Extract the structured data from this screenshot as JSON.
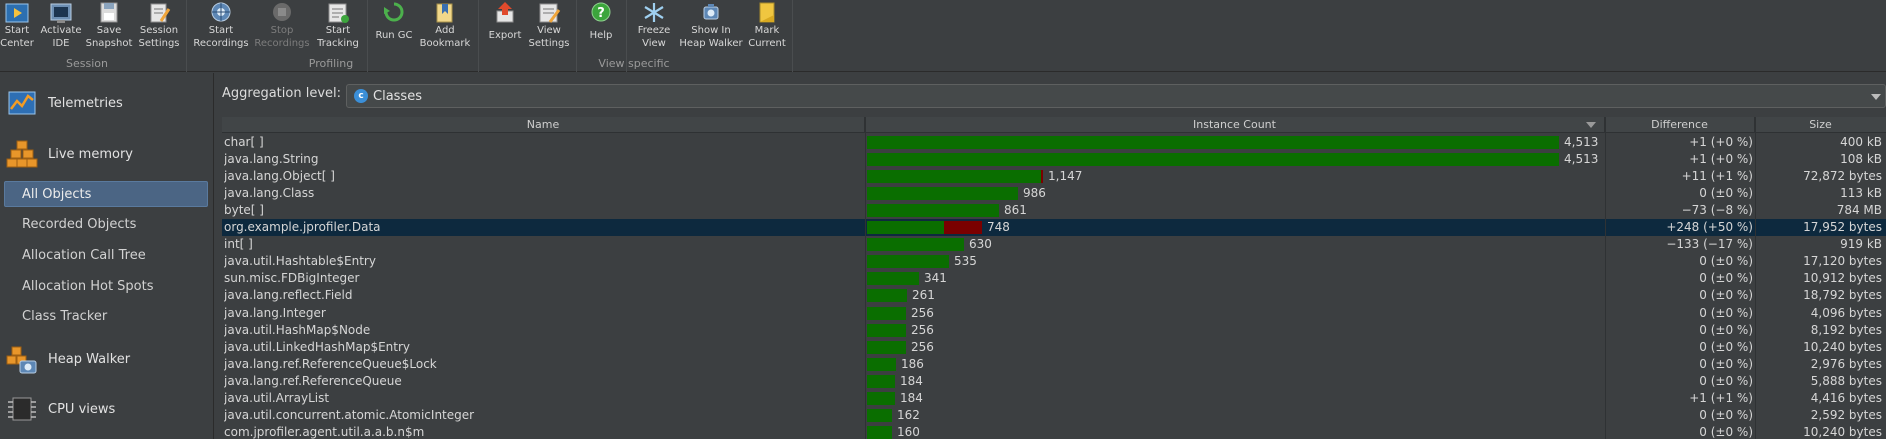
{
  "toolbar": {
    "buttons": [
      {
        "label": "Start\nCenter",
        "icon": "start-center-icon"
      },
      {
        "label": "Activate\nIDE",
        "icon": "activate-ide-icon"
      },
      {
        "label": "Save\nSnapshot",
        "icon": "save-snapshot-icon"
      },
      {
        "label": "Session\nSettings",
        "icon": "session-settings-icon"
      },
      {
        "label": "Start\nRecordings",
        "icon": "start-recordings-icon"
      },
      {
        "label": "Stop\nRecordings",
        "icon": "stop-recordings-icon",
        "disabled": true
      },
      {
        "label": "Start\nTracking",
        "icon": "start-tracking-icon"
      },
      {
        "label": "Run GC",
        "icon": "run-gc-icon"
      },
      {
        "label": "Add\nBookmark",
        "icon": "add-bookmark-icon"
      },
      {
        "label": "Export",
        "icon": "export-icon"
      },
      {
        "label": "View\nSettings",
        "icon": "view-settings-icon"
      },
      {
        "label": "Help",
        "icon": "help-icon"
      },
      {
        "label": "Freeze\nView",
        "icon": "freeze-view-icon"
      },
      {
        "label": "Show In\nHeap Walker",
        "icon": "show-in-heap-walker-icon"
      },
      {
        "label": "Mark\nCurrent",
        "icon": "mark-current-icon"
      }
    ],
    "groups": [
      "Session",
      "Profiling",
      "View specific"
    ]
  },
  "sidebar": {
    "sections": [
      {
        "label": "Telemetries",
        "icon": "telemetries-icon"
      },
      {
        "label": "Live memory",
        "icon": "live-memory-icon"
      },
      {
        "label": "Heap Walker",
        "icon": "heap-walker-icon"
      },
      {
        "label": "CPU views",
        "icon": "cpu-views-icon"
      }
    ],
    "items": [
      "All Objects",
      "Recorded Objects",
      "Allocation Call Tree",
      "Allocation Hot Spots",
      "Class Tracker"
    ],
    "selected_item": "All Objects"
  },
  "aggregation": {
    "label": "Aggregation level:",
    "value": "Classes",
    "icon_letter": "c"
  },
  "table": {
    "columns": [
      "Name",
      "Instance Count",
      "Difference",
      "Size"
    ],
    "sorted_column": "Instance Count",
    "max_count": 4513,
    "rows": [
      {
        "name": "char[ ]",
        "count": 4513,
        "count_label": "4,513",
        "new": 1,
        "diff": "+1 (+0 %)",
        "size": "400 kB"
      },
      {
        "name": "java.lang.String",
        "count": 4513,
        "count_label": "4,513",
        "new": 1,
        "diff": "+1 (+0 %)",
        "size": "108 kB"
      },
      {
        "name": "java.lang.Object[ ]",
        "count": 1147,
        "count_label": "1,147",
        "new": 11,
        "diff": "+11 (+1 %)",
        "size": "72,872 bytes"
      },
      {
        "name": "java.lang.Class",
        "count": 986,
        "count_label": "986",
        "new": 0,
        "diff": "0 (±0 %)",
        "size": "113 kB"
      },
      {
        "name": "byte[ ]",
        "count": 861,
        "count_label": "861",
        "new": 0,
        "diff": "−73 (−8 %)",
        "size": "784 MB"
      },
      {
        "name": "org.example.jprofiler.Data",
        "count": 748,
        "count_label": "748",
        "new": 248,
        "diff": "+248 (+50 %)",
        "size": "17,952 bytes",
        "selected": true
      },
      {
        "name": "int[ ]",
        "count": 630,
        "count_label": "630",
        "new": 0,
        "diff": "−133 (−17 %)",
        "size": "919 kB"
      },
      {
        "name": "java.util.Hashtable$Entry",
        "count": 535,
        "count_label": "535",
        "new": 0,
        "diff": "0 (±0 %)",
        "size": "17,120 bytes"
      },
      {
        "name": "sun.misc.FDBigInteger",
        "count": 341,
        "count_label": "341",
        "new": 0,
        "diff": "0 (±0 %)",
        "size": "10,912 bytes"
      },
      {
        "name": "java.lang.reflect.Field",
        "count": 261,
        "count_label": "261",
        "new": 0,
        "diff": "0 (±0 %)",
        "size": "18,792 bytes"
      },
      {
        "name": "java.lang.Integer",
        "count": 256,
        "count_label": "256",
        "new": 0,
        "diff": "0 (±0 %)",
        "size": "4,096 bytes"
      },
      {
        "name": "java.util.HashMap$Node",
        "count": 256,
        "count_label": "256",
        "new": 0,
        "diff": "0 (±0 %)",
        "size": "8,192 bytes"
      },
      {
        "name": "java.util.LinkedHashMap$Entry",
        "count": 256,
        "count_label": "256",
        "new": 0,
        "diff": "0 (±0 %)",
        "size": "10,240 bytes"
      },
      {
        "name": "java.lang.ref.ReferenceQueue$Lock",
        "count": 186,
        "count_label": "186",
        "new": 0,
        "diff": "0 (±0 %)",
        "size": "2,976 bytes"
      },
      {
        "name": "java.lang.ref.ReferenceQueue",
        "count": 184,
        "count_label": "184",
        "new": 0,
        "diff": "0 (±0 %)",
        "size": "5,888 bytes"
      },
      {
        "name": "java.util.ArrayList",
        "count": 184,
        "count_label": "184",
        "new": 1,
        "diff": "+1 (+1 %)",
        "size": "4,416 bytes"
      },
      {
        "name": "java.util.concurrent.atomic.AtomicInteger",
        "count": 162,
        "count_label": "162",
        "new": 0,
        "diff": "0 (±0 %)",
        "size": "2,592 bytes"
      },
      {
        "name": "com.jprofiler.agent.util.a.a.b.n$m",
        "count": 160,
        "count_label": "160",
        "new": 0,
        "diff": "0 (±0 %)",
        "size": "10,240 bytes"
      }
    ]
  },
  "colors": {
    "bar_base": "#0a6e00",
    "bar_new": "#7a0000",
    "selection_row": "#0d293e",
    "sidebar_selection": "#4b6584"
  }
}
